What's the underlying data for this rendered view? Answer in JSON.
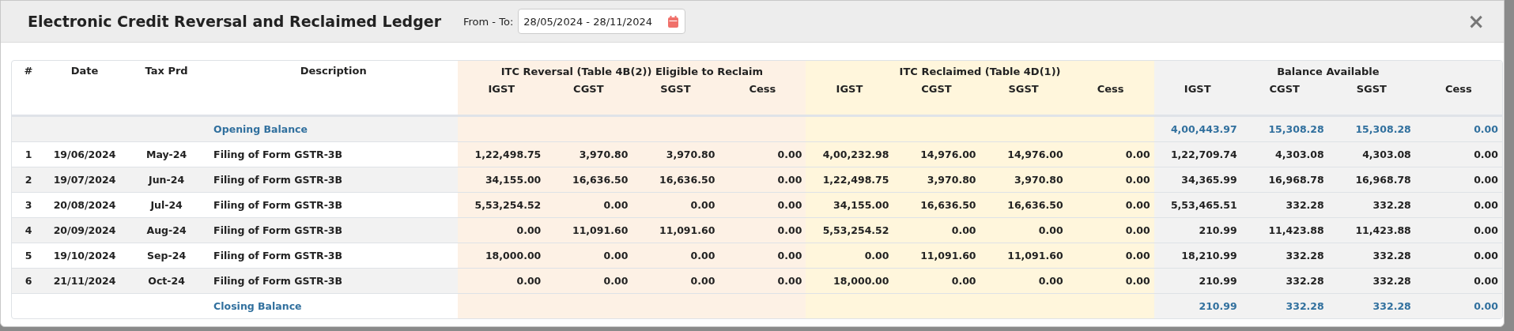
{
  "dialog": {
    "title": "Electronic Credit Reversal and Reclaimed Ledger",
    "range_label": "From - To:",
    "range_value": "28/05/2024 - 28/11/2024",
    "close": "×"
  },
  "table": {
    "columns": [
      "#",
      "Date",
      "Tax Prd",
      "Description"
    ],
    "groups": [
      {
        "kind": "reversal",
        "title": "ITC Reversal (Table 4B(2)) Eligible to Reclaim",
        "columns": [
          "IGST",
          "CGST",
          "SGST",
          "Cess"
        ]
      },
      {
        "kind": "reclaimed",
        "title": "ITC Reclaimed (Table 4D(1))",
        "columns": [
          "IGST",
          "CGST",
          "SGST",
          "Cess"
        ]
      },
      {
        "kind": "balance",
        "title": "Balance Available",
        "columns": [
          "IGST",
          "CGST",
          "SGST",
          "Cess"
        ]
      }
    ],
    "rows": [
      {
        "kind": "summary",
        "description": "Opening Balance",
        "balance": [
          "4,00,443.97",
          "15,308.28",
          "15,308.28",
          "0.00"
        ]
      },
      {
        "kind": "entry",
        "no": "1",
        "date": "19/06/2024",
        "tax_prd": "May-24",
        "description": "Filing of Form GSTR-3B",
        "reversal": [
          "1,22,498.75",
          "3,970.80",
          "3,970.80",
          "0.00"
        ],
        "reclaimed": [
          "4,00,232.98",
          "14,976.00",
          "14,976.00",
          "0.00"
        ],
        "balance": [
          "1,22,709.74",
          "4,303.08",
          "4,303.08",
          "0.00"
        ]
      },
      {
        "kind": "entry",
        "no": "2",
        "date": "19/07/2024",
        "tax_prd": "Jun-24",
        "description": "Filing of Form GSTR-3B",
        "reversal": [
          "34,155.00",
          "16,636.50",
          "16,636.50",
          "0.00"
        ],
        "reclaimed": [
          "1,22,498.75",
          "3,970.80",
          "3,970.80",
          "0.00"
        ],
        "balance": [
          "34,365.99",
          "16,968.78",
          "16,968.78",
          "0.00"
        ]
      },
      {
        "kind": "entry",
        "no": "3",
        "date": "20/08/2024",
        "tax_prd": "Jul-24",
        "description": "Filing of Form GSTR-3B",
        "reversal": [
          "5,53,254.52",
          "0.00",
          "0.00",
          "0.00"
        ],
        "reclaimed": [
          "34,155.00",
          "16,636.50",
          "16,636.50",
          "0.00"
        ],
        "balance": [
          "5,53,465.51",
          "332.28",
          "332.28",
          "0.00"
        ]
      },
      {
        "kind": "entry",
        "no": "4",
        "date": "20/09/2024",
        "tax_prd": "Aug-24",
        "description": "Filing of Form GSTR-3B",
        "reversal": [
          "0.00",
          "11,091.60",
          "11,091.60",
          "0.00"
        ],
        "reclaimed": [
          "5,53,254.52",
          "0.00",
          "0.00",
          "0.00"
        ],
        "balance": [
          "210.99",
          "11,423.88",
          "11,423.88",
          "0.00"
        ]
      },
      {
        "kind": "entry",
        "no": "5",
        "date": "19/10/2024",
        "tax_prd": "Sep-24",
        "description": "Filing of Form GSTR-3B",
        "reversal": [
          "18,000.00",
          "0.00",
          "0.00",
          "0.00"
        ],
        "reclaimed": [
          "0.00",
          "11,091.60",
          "11,091.60",
          "0.00"
        ],
        "balance": [
          "18,210.99",
          "332.28",
          "332.28",
          "0.00"
        ]
      },
      {
        "kind": "entry",
        "no": "6",
        "date": "21/11/2024",
        "tax_prd": "Oct-24",
        "description": "Filing of Form GSTR-3B",
        "reversal": [
          "0.00",
          "0.00",
          "0.00",
          "0.00"
        ],
        "reclaimed": [
          "18,000.00",
          "0.00",
          "0.00",
          "0.00"
        ],
        "balance": [
          "210.99",
          "332.28",
          "332.28",
          "0.00"
        ]
      },
      {
        "kind": "summary",
        "description": "Closing Balance",
        "balance": [
          "210.99",
          "332.28",
          "332.28",
          "0.00"
        ]
      }
    ]
  }
}
